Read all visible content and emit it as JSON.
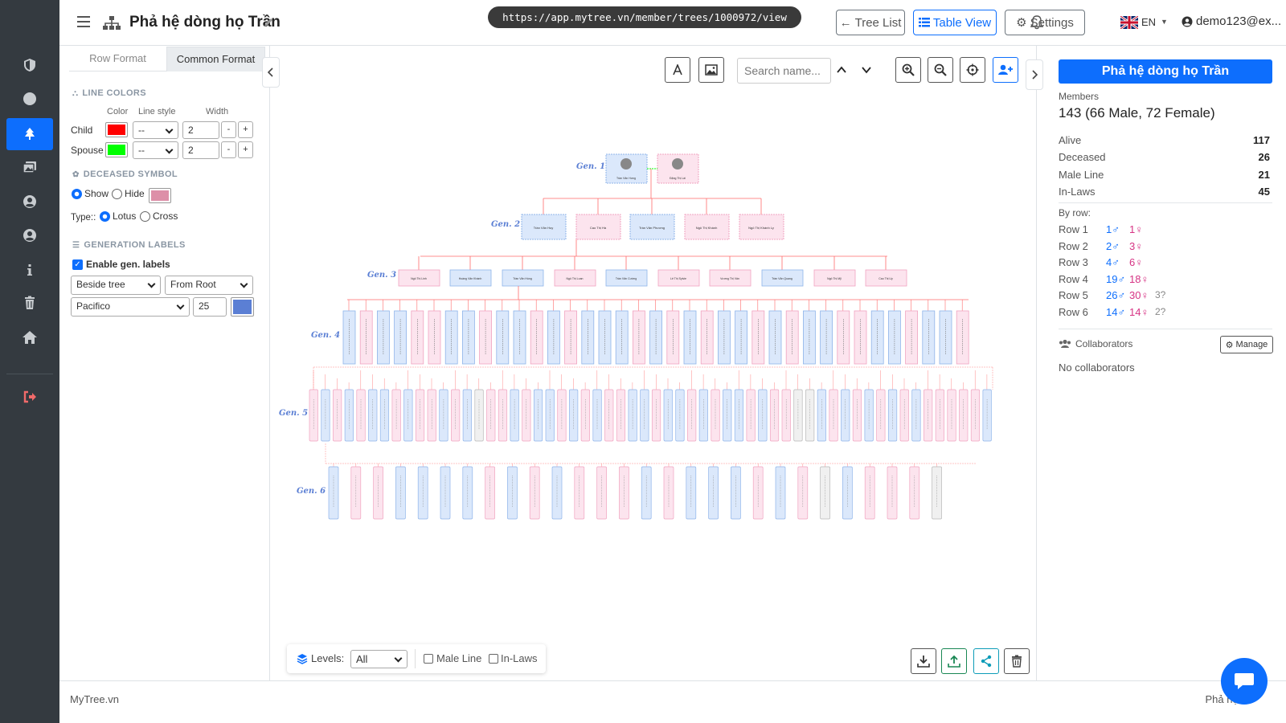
{
  "app": {
    "name": "MyTree.vn",
    "footer_right": "Phả hệ số"
  },
  "header": {
    "title": "Phả hệ dòng họ Trần",
    "url": "https://app.mytree.vn/member/trees/1000972/view",
    "tree_list_label": "Tree List",
    "table_view_label": "Table View",
    "settings_label": "Settings",
    "lang": "EN",
    "user": "demo123@ex..."
  },
  "sidebar": {
    "items": [
      "shield-icon",
      "circle-icon",
      "tree-icon",
      "images-icon",
      "user-circle-icon",
      "user-icon",
      "info-icon",
      "trash-icon",
      "home-icon",
      "logout-icon"
    ]
  },
  "left_panel": {
    "tabs": [
      {
        "label": "Row Format"
      },
      {
        "label": "Common Format"
      }
    ],
    "line_colors": {
      "heading": "LINE COLORS",
      "col_color": "Color",
      "col_style": "Line style",
      "col_width": "Width",
      "rows": [
        {
          "label": "Child",
          "color": "#ff0000",
          "style": "--",
          "width": "2"
        },
        {
          "label": "Spouse",
          "color": "#00ff00",
          "style": "--",
          "width": "2"
        }
      ]
    },
    "deceased": {
      "heading": "DECEASED SYMBOL",
      "show": "Show",
      "hide": "Hide",
      "color": "#dd8fa8",
      "type_label": "Type::",
      "lotus": "Lotus",
      "cross": "Cross"
    },
    "gen_labels": {
      "heading": "GENERATION LABELS",
      "enable": "Enable gen. labels",
      "position": "Beside tree",
      "origin": "From Root",
      "font": "Pacifico",
      "size": "25",
      "color": "#5b7fd4"
    }
  },
  "canvas": {
    "search_placeholder": "Search name...",
    "generations": [
      {
        "label": "Gen. 1",
        "nodes": [
          {
            "name": "Trần Văn Hưng",
            "s": "m"
          },
          {
            "name": "Đặng Thị Lài",
            "s": "f"
          }
        ]
      },
      {
        "label": "Gen. 2",
        "nodes": [
          {
            "name": "Trần Văn Huy",
            "s": "m"
          },
          {
            "name": "Cao Thị Hà",
            "s": "f"
          },
          {
            "name": "Trần Văn Phương",
            "s": "m"
          },
          {
            "name": "Ngô Thị Khánh",
            "s": "f"
          },
          {
            "name": "Ngô Thị Khánh Ly",
            "s": "f"
          }
        ]
      },
      {
        "label": "Gen. 3",
        "nodes": [
          {
            "name": "Ngô Thị Linh",
            "s": "f"
          },
          {
            "name": "Hoàng Văn Khánh",
            "s": "m"
          },
          {
            "name": "Trần Văn Hùng",
            "s": "m"
          },
          {
            "name": "Ngô Thị Loan",
            "s": "f"
          },
          {
            "name": "Trần Văn Cường",
            "s": "m"
          },
          {
            "name": "Lê Thị Sylvie",
            "s": "f"
          },
          {
            "name": "Vương Thị Vân",
            "s": "f"
          },
          {
            "name": "Trần Văn Quang",
            "s": "m"
          },
          {
            "name": "Ngô Thị Mỹ",
            "s": "f"
          },
          {
            "name": "Cao Thị Uy",
            "s": "f"
          }
        ]
      },
      {
        "label": "Gen. 4"
      },
      {
        "label": "Gen. 5"
      },
      {
        "label": "Gen. 6"
      }
    ],
    "levels_label": "Levels:",
    "levels_value": "All",
    "male_line": "Male Line",
    "inlaws": "In-Laws"
  },
  "right_panel": {
    "title": "Phả hệ dòng họ Trần",
    "members_label": "Members",
    "members_value": "143 (66 Male, 72 Female)",
    "stats": [
      {
        "label": "Alive",
        "value": "117"
      },
      {
        "label": "Deceased",
        "value": "26"
      },
      {
        "label": "Male Line",
        "value": "21"
      },
      {
        "label": "In-Laws",
        "value": "45"
      }
    ],
    "by_row_label": "By row:",
    "rows": [
      {
        "label": "Row 1",
        "male": "1♂",
        "female": "1♀",
        "other": ""
      },
      {
        "label": "Row 2",
        "male": "2♂",
        "female": "3♀",
        "other": ""
      },
      {
        "label": "Row 3",
        "male": "4♂",
        "female": "6♀",
        "other": ""
      },
      {
        "label": "Row 4",
        "male": "19♂",
        "female": "18♀",
        "other": ""
      },
      {
        "label": "Row 5",
        "male": "26♂",
        "female": "30♀",
        "other": "3?"
      },
      {
        "label": "Row 6",
        "male": "14♂",
        "female": "14♀",
        "other": "2?"
      }
    ],
    "collaborators_label": "Collaborators",
    "manage_label": "Manage",
    "no_collab": "No collaborators"
  },
  "colors": {
    "accent": "#0d6efd",
    "male_fill": "#dbe8fb",
    "female_fill": "#fce4ee",
    "unknown_fill": "#f0f0f0",
    "child_line": "#ff0000",
    "spouse_line": "#00ff00"
  }
}
